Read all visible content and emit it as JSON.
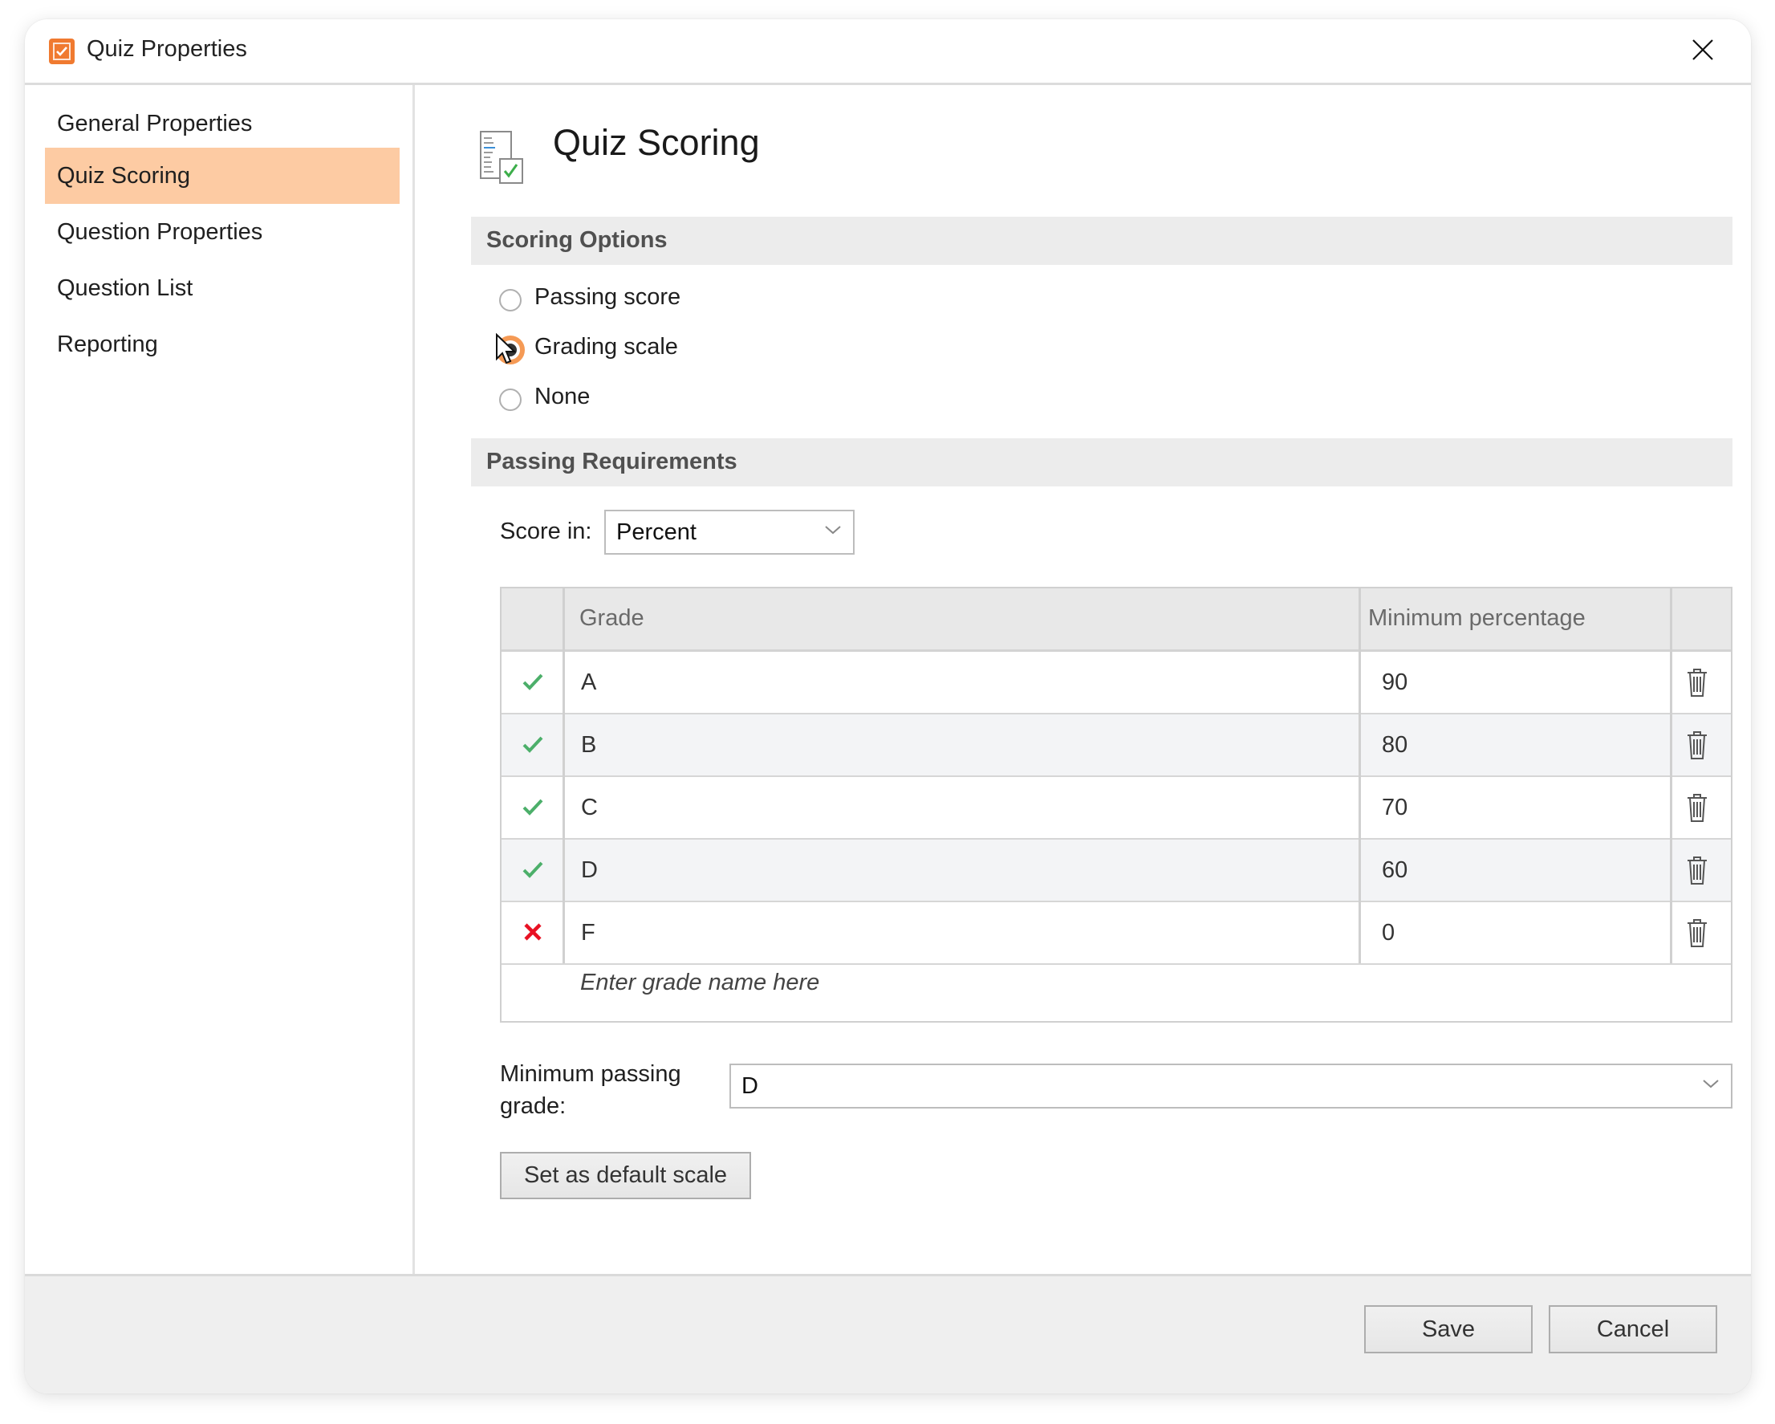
{
  "window": {
    "title": "Quiz Properties",
    "app_icon": "quiz-checkbox-icon",
    "close_icon": "close-icon",
    "accent_color": "#f07a30"
  },
  "sidebar": {
    "items": [
      {
        "label": "General Properties",
        "active": false
      },
      {
        "label": "Quiz Scoring",
        "active": true
      },
      {
        "label": "Question Properties",
        "active": false
      },
      {
        "label": "Question List",
        "active": false
      },
      {
        "label": "Reporting",
        "active": false
      }
    ],
    "active_color": "#fdcba3"
  },
  "main": {
    "title": "Quiz Scoring",
    "icon": "quiz-scoring-icon",
    "scoring_options": {
      "heading": "Scoring Options",
      "options": [
        {
          "label": "Passing score",
          "checked": false
        },
        {
          "label": "Grading scale",
          "checked": true
        },
        {
          "label": "None",
          "checked": false
        }
      ]
    },
    "passing_requirements": {
      "heading": "Passing Requirements",
      "score_in_label": "Score in:",
      "score_in_value": "Percent",
      "table": {
        "columns": [
          "",
          "Grade",
          "Minimum percentage",
          ""
        ],
        "rows": [
          {
            "status": "pass",
            "grade": "A",
            "min": "90"
          },
          {
            "status": "pass",
            "grade": "B",
            "min": "80"
          },
          {
            "status": "pass",
            "grade": "C",
            "min": "70"
          },
          {
            "status": "pass",
            "grade": "D",
            "min": "60"
          },
          {
            "status": "fail",
            "grade": "F",
            "min": "0"
          }
        ],
        "new_row_placeholder": "Enter grade name here",
        "pass_color": "#4caf6a",
        "fail_color": "#e81123"
      },
      "min_passing_label_line1": "Minimum passing",
      "min_passing_label_line2": "grade:",
      "min_passing_value": "D",
      "default_button": "Set as default scale"
    }
  },
  "footer": {
    "save": "Save",
    "cancel": "Cancel"
  }
}
